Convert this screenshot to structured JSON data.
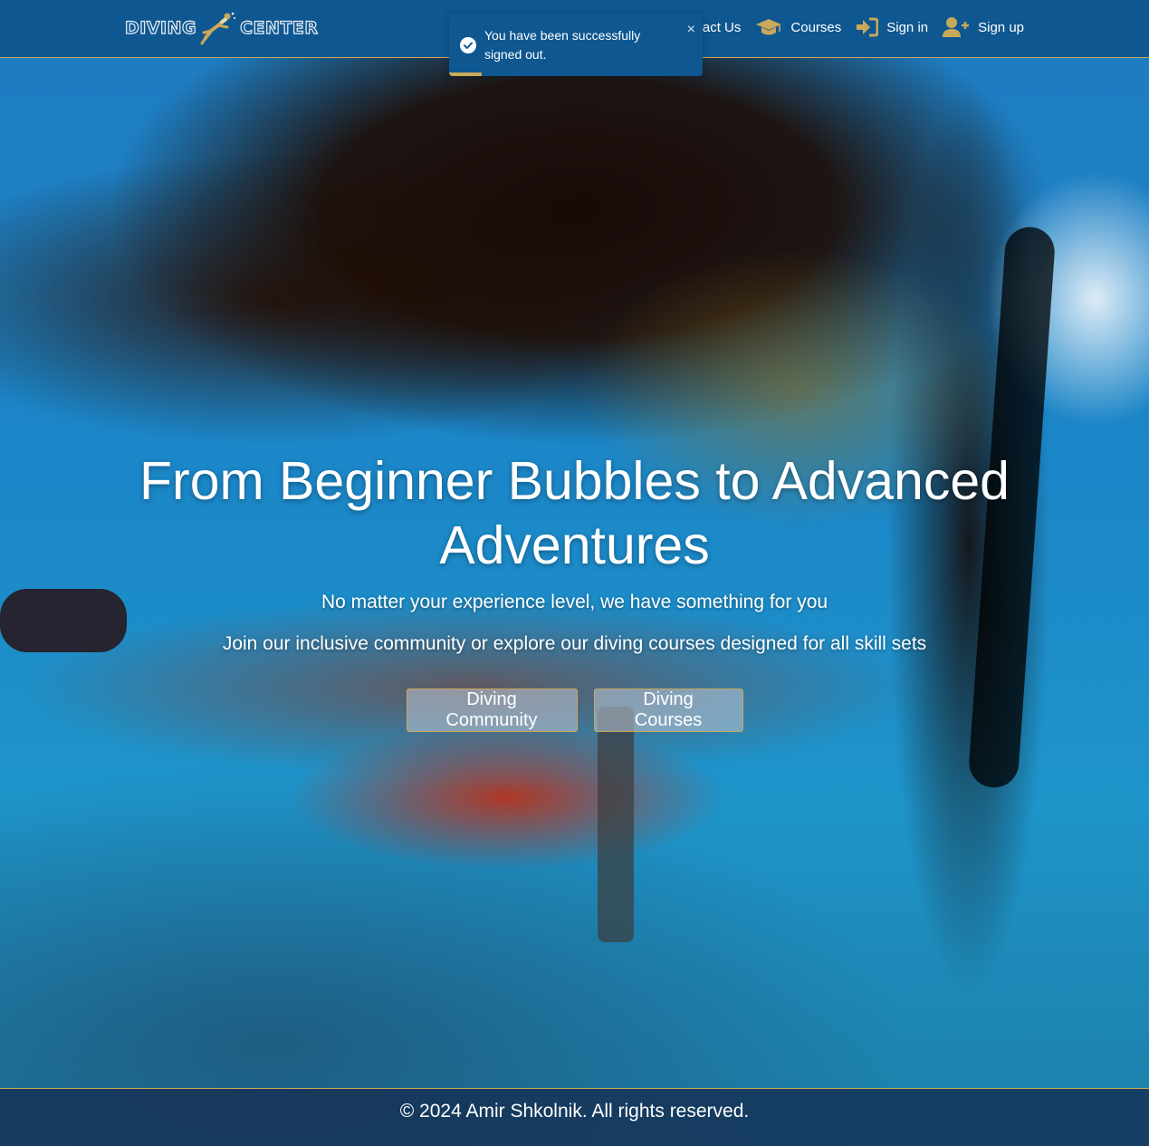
{
  "navbar": {
    "logo": {
      "word_left": "DIVING",
      "word_right": "CENTER",
      "icon": "diver-icon"
    },
    "links": [
      {
        "label": "Contact Us",
        "visible_label": "ntact Us",
        "icon": "envelope-icon"
      },
      {
        "label": "Courses",
        "icon": "graduation-cap-icon"
      },
      {
        "label": "Sign in",
        "icon": "sign-in-icon"
      },
      {
        "label": "Sign up",
        "icon": "user-plus-icon"
      }
    ]
  },
  "toast": {
    "message": "You have been successfully signed out.",
    "icon": "check-circle-icon",
    "close_label": "×",
    "progress": 0.13
  },
  "hero": {
    "title": "From Beginner Bubbles to Advanced Adventures",
    "subtitle": "No matter your experience level, we have something for you",
    "tagline": "Join our inclusive community or explore our diving courses designed for all skill sets",
    "buttons": {
      "community": "Diving Community",
      "courses": "Diving Courses"
    }
  },
  "footer": {
    "copyright": "© 2024 Amir Shkolnik. All rights reserved."
  },
  "colors": {
    "navbar_bg": "#0e5791",
    "accent_gold": "#c9a85a",
    "text": "#ffffff"
  }
}
